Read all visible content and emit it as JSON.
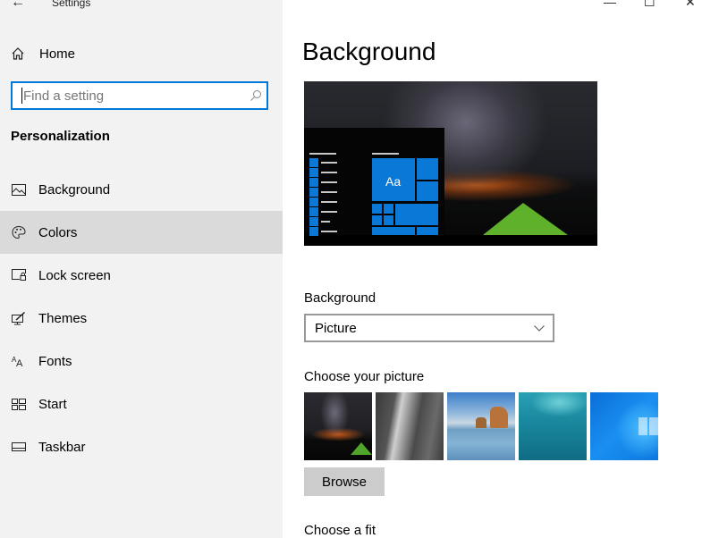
{
  "window": {
    "title": "Settings",
    "back_icon": "arrow-left",
    "controls": {
      "minimize": "—",
      "maximize": "☐",
      "close": "✕"
    }
  },
  "sidebar": {
    "home_label": "Home",
    "search": {
      "placeholder": "Find a setting",
      "value": ""
    },
    "section_title": "Personalization",
    "items": [
      {
        "label": "Background",
        "icon": "picture-icon",
        "active": false
      },
      {
        "label": "Colors",
        "icon": "palette-icon",
        "active": true
      },
      {
        "label": "Lock screen",
        "icon": "lock-screen-icon",
        "active": false
      },
      {
        "label": "Themes",
        "icon": "themes-icon",
        "active": false
      },
      {
        "label": "Fonts",
        "icon": "fonts-icon",
        "active": false
      },
      {
        "label": "Start",
        "icon": "start-icon",
        "active": false
      },
      {
        "label": "Taskbar",
        "icon": "taskbar-icon",
        "active": false
      }
    ]
  },
  "main": {
    "title": "Background",
    "preview": {
      "sample_text": "Aa",
      "accent": "#0a78d7"
    },
    "background_label": "Background",
    "background_select": {
      "value": "Picture"
    },
    "choose_picture_label": "Choose your picture",
    "pictures": [
      {
        "name": "night-sky-tent"
      },
      {
        "name": "rock-waterfall"
      },
      {
        "name": "beach-rocks"
      },
      {
        "name": "underwater-swimmer"
      },
      {
        "name": "windows-blue"
      }
    ],
    "browse_label": "Browse",
    "choose_fit_label": "Choose a fit"
  },
  "colors": {
    "accent": "#0078d7",
    "sidebar_bg": "#f2f2f2",
    "active_item_bg": "#dadada"
  }
}
